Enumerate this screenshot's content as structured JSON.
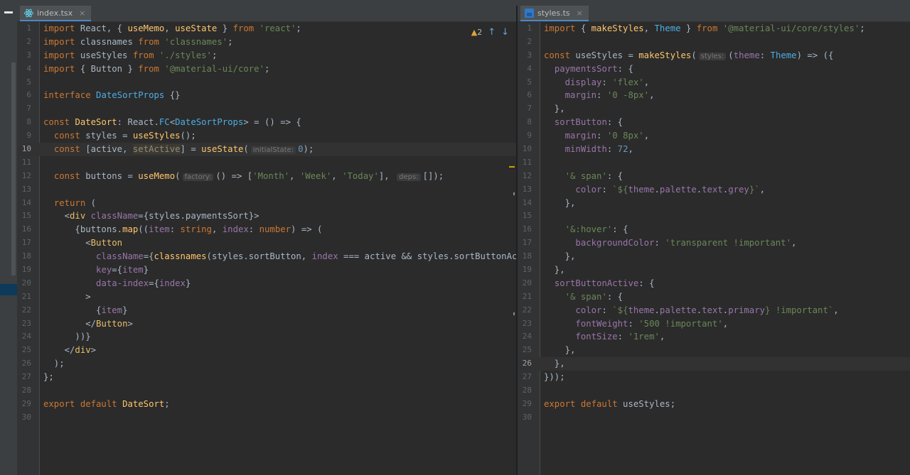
{
  "left_tab": {
    "title": "index.tsx",
    "close": "×"
  },
  "right_tab": {
    "title": "styles.ts",
    "close": "×"
  },
  "inspection": {
    "warning_icon": "warning-triangle",
    "warning_count": "2",
    "up": "↑",
    "down": "↓"
  },
  "left_lines": [
    "1",
    "2",
    "3",
    "4",
    "5",
    "6",
    "7",
    "8",
    "9",
    "10",
    "11",
    "12",
    "13",
    "14",
    "15",
    "16",
    "17",
    "18",
    "19",
    "20",
    "21",
    "22",
    "23",
    "24",
    "25",
    "26",
    "27",
    "28",
    "29",
    "30"
  ],
  "right_lines": [
    "1",
    "2",
    "3",
    "4",
    "5",
    "6",
    "7",
    "8",
    "9",
    "10",
    "11",
    "12",
    "13",
    "14",
    "15",
    "16",
    "17",
    "18",
    "19",
    "20",
    "21",
    "22",
    "23",
    "24",
    "25",
    "26",
    "27",
    "28",
    "29",
    "30"
  ],
  "colors": {
    "keyword": "#cc7832",
    "string": "#6a8759",
    "number": "#6897bb",
    "function": "#ffc66d",
    "property": "#9876aa",
    "accent": "#4a88c7"
  }
}
